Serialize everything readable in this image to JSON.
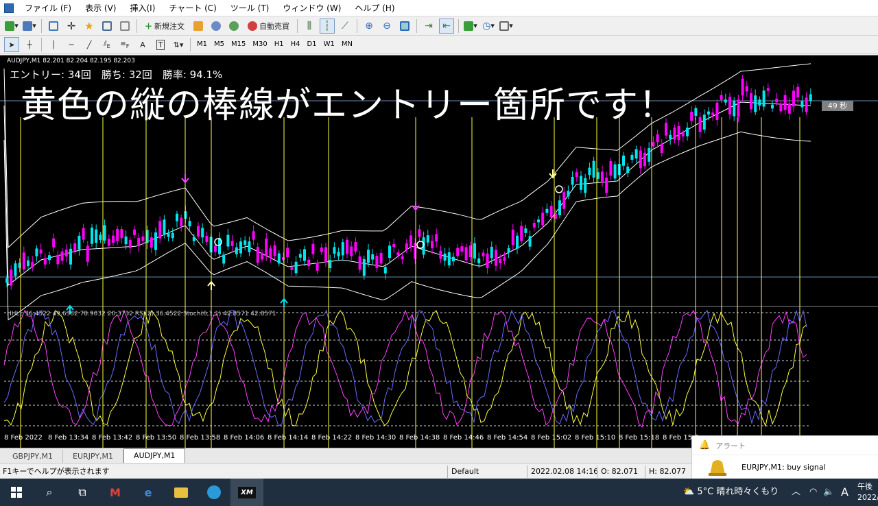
{
  "menubar": {
    "items": [
      "ファイル (F)",
      "表示 (V)",
      "挿入(I)",
      "チャート (C)",
      "ツール (T)",
      "ウィンドウ (W)",
      "ヘルプ (H)"
    ]
  },
  "toolbar": {
    "new_order": "新規注文",
    "auto_trade": "自動売買",
    "timeframes": [
      "M1",
      "M5",
      "M15",
      "M30",
      "H1",
      "H4",
      "D1",
      "W1",
      "MN"
    ],
    "draw_labels": {
      "e": "E",
      "f": "F",
      "a": "A",
      "t": "T"
    }
  },
  "chart": {
    "symbol_line": "AUDJPY,M1  82.201 82.204 82.195 82.203",
    "stats": "エントリー: 34回　勝ち: 32回　勝率: 94.1%",
    "overlay_title": "黄色の縦の棒線がエントリー箇所です！",
    "countdown": "49 秒",
    "indicator_line": "HHLL 36.4522 49.6382 78.9032 20.3732  RSI(2) 36.4522  Stoch(6,1,1) 42.8571 42.8571",
    "time_labels": [
      "8 Feb 2022",
      "8 Feb 13:34",
      "8 Feb 13:42",
      "8 Feb 13:50",
      "8 Feb 13:58",
      "8 Feb 14:06",
      "8 Feb 14:14",
      "8 Feb 14:22",
      "8 Feb 14:30",
      "8 Feb 14:38",
      "8 Feb 14:46",
      "8 Feb 14:54",
      "8 Feb 15:02",
      "8 Feb 15:10",
      "8 Feb 15:18",
      "8 Feb 15:2"
    ],
    "colors": {
      "up": "#00e5ee",
      "down": "#ff00ff",
      "signal": "#ffff40",
      "band": "#ffffff",
      "bg": "#000000"
    }
  },
  "tabs": [
    "GBPJPY,M1",
    "EURJPY,M1",
    "AUDJPY,M1"
  ],
  "active_tab": "AUDJPY,M1",
  "status": {
    "help": "F1キーでヘルプが表示されます",
    "profile": "Default",
    "datetime": "2022.02.08 14:16",
    "open": "O: 82.071",
    "high": "H: 82.077"
  },
  "alert": {
    "title": "アラート",
    "message": "EURJPY,M1: buy signal"
  },
  "taskbar": {
    "weather": "5°C  晴れ時々くもり",
    "ime": "A",
    "time": "午後",
    "date": "2022/"
  }
}
